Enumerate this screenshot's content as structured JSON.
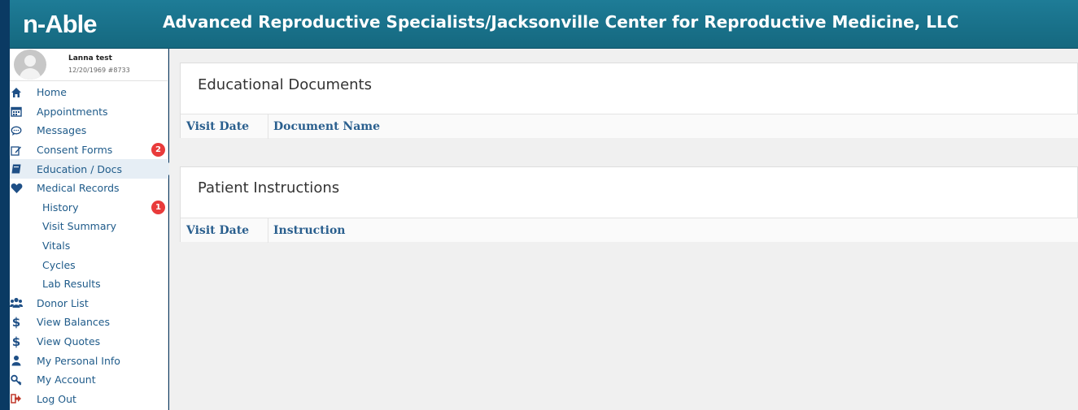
{
  "header": {
    "logo": "n-Able",
    "org_title": "Advanced Reproductive Specialists/Jacksonville Center for Reproductive Medicine, LLC"
  },
  "profile": {
    "name": "Lanna test",
    "meta": "12/20/1969 #8733"
  },
  "nav": {
    "items": [
      {
        "label": "Home",
        "icon": "home-icon"
      },
      {
        "label": "Appointments",
        "icon": "calendar-icon"
      },
      {
        "label": "Messages",
        "icon": "chat-icon"
      },
      {
        "label": "Consent Forms",
        "icon": "edit-icon",
        "badge": "2"
      },
      {
        "label": "Education / Docs",
        "icon": "book-icon",
        "active": true
      },
      {
        "label": "Medical Records",
        "icon": "heart-icon"
      },
      {
        "label": "History",
        "sub": true,
        "badge": "1"
      },
      {
        "label": "Visit Summary",
        "sub": true
      },
      {
        "label": "Vitals",
        "sub": true
      },
      {
        "label": "Cycles",
        "sub": true
      },
      {
        "label": "Lab Results",
        "sub": true
      },
      {
        "label": "Donor List",
        "icon": "users-icon"
      },
      {
        "label": "View Balances",
        "icon": "dollar-icon"
      },
      {
        "label": "View Quotes",
        "icon": "dollar-icon"
      },
      {
        "label": "My Personal Info",
        "icon": "user-icon"
      },
      {
        "label": "My Account",
        "icon": "key-icon"
      },
      {
        "label": "Log Out",
        "icon": "logout-icon"
      }
    ]
  },
  "education": {
    "title": "Educational Documents",
    "col1": "Visit Date",
    "col2": "Document Name"
  },
  "instructions": {
    "title": "Patient Instructions",
    "col1": "Visit Date",
    "col2": "Instruction"
  },
  "colors": {
    "header": "#1e7c97",
    "link": "#1f5b8a",
    "badge": "#e93b3b"
  }
}
